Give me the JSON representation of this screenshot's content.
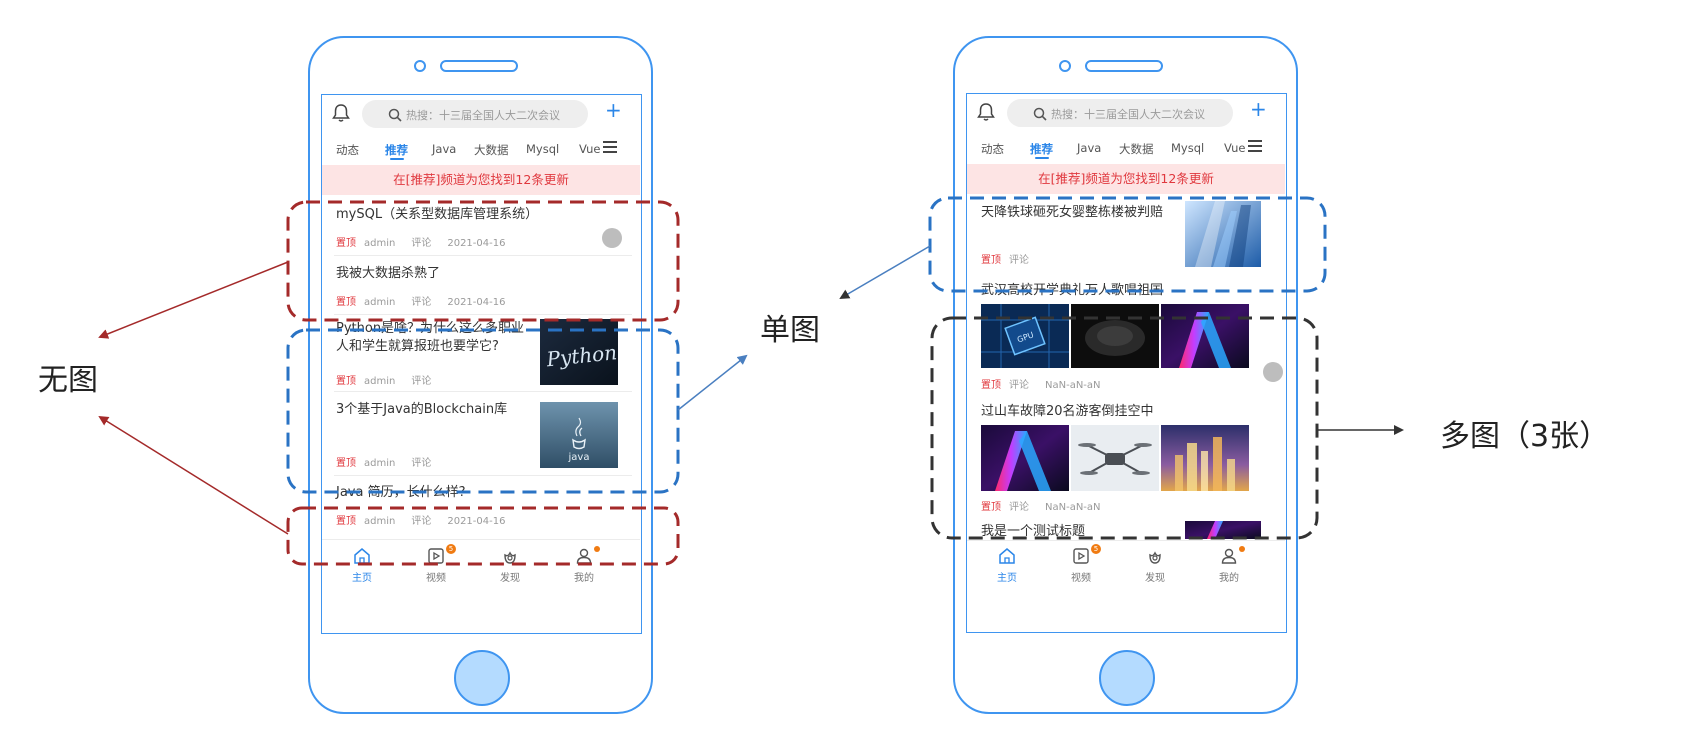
{
  "labels": {
    "no_image": "无图",
    "single_image": "单图",
    "multi_image": "多图（3张）"
  },
  "phone": {
    "search_placeholder": "热搜：十三届全国人大二次会议",
    "plus": "+",
    "tabs": [
      "动态",
      "推荐",
      "Java",
      "大数据",
      "Mysql",
      "Vue"
    ],
    "active_tab": "推荐",
    "notice": "在[推荐]频道为您找到12条更新",
    "nav": [
      {
        "label": "主页",
        "icon": "home-icon",
        "active": true
      },
      {
        "label": "视频",
        "icon": "video-icon",
        "badge": "5"
      },
      {
        "label": "发现",
        "icon": "discover-icon"
      },
      {
        "label": "我的",
        "icon": "user-icon",
        "dot": true
      }
    ]
  },
  "left_feed": [
    {
      "title": "mySQL（关系型数据库管理系统）",
      "tag": "置顶",
      "author": "admin",
      "comment": "评论",
      "date": "2021-04-16"
    },
    {
      "title": "我被大数据杀熟了",
      "tag": "置顶",
      "author": "admin",
      "comment": "评论",
      "date": "2021-04-16"
    },
    {
      "title_line1": "Python是啥？为什么这么多职业",
      "title_line2": "人和学生就算报班也要学它?",
      "tag": "置顶",
      "author": "admin",
      "comment": "评论",
      "thumb_text": "Python"
    },
    {
      "title": "3个基于Java的Blockchain库",
      "tag": "置顶",
      "author": "admin",
      "comment": "评论",
      "thumb_text": "java"
    },
    {
      "title": "Java 简历，长什么样?",
      "tag": "置顶",
      "author": "admin",
      "comment": "评论",
      "date": "2021-04-16"
    }
  ],
  "right_feed": [
    {
      "title": "天降铁球砸死女婴整栋楼被判赔",
      "tag": "置顶",
      "comment": "评论"
    },
    {
      "title": "武汉高校开学典礼万人歌唱祖国",
      "tag": "置顶",
      "comment": "评论",
      "date": "NaN-aN-aN",
      "chip_text": "GPU"
    },
    {
      "title": "过山车故障20名游客倒挂空中",
      "tag": "置顶",
      "comment": "评论",
      "date": "NaN-aN-aN"
    },
    {
      "title": "我是一个测试标题"
    }
  ],
  "colors": {
    "accent": "#2b86e8",
    "phone_outline": "#3f95f0",
    "red_box": "#a42a2a",
    "blue_box": "#2a73c4",
    "black_box": "#333333",
    "tag_red": "#e0383e"
  }
}
